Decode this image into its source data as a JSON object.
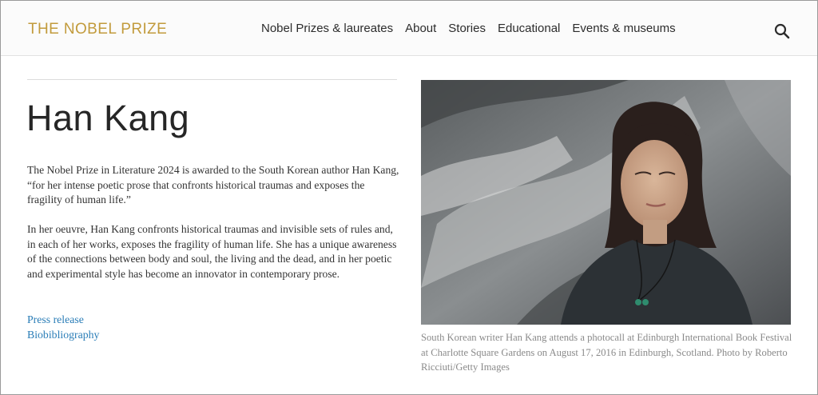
{
  "header": {
    "brand": "THE NOBEL PRIZE",
    "nav": [
      "Nobel Prizes & laureates",
      "About",
      "Stories",
      "Educational",
      "Events & museums"
    ],
    "search_icon": "search-icon"
  },
  "main": {
    "title": "Han Kang",
    "paragraphs": [
      "The Nobel Prize in Literature 2024 is awarded to the South Korean author Han Kang, “for her intense poetic prose that confronts historical traumas and exposes the fragility of human life.”",
      "In her oeuvre, Han Kang confronts historical traumas and invisible sets of rules and, in each of her works, exposes the fragility of human life. She has a unique awareness of the connections between body and soul, the living and the dead, and in her poetic and experimental style has become an innovator in contemporary prose."
    ],
    "links": [
      "Press release",
      "Biobibliography"
    ]
  },
  "photo": {
    "caption": "South Korean writer Han Kang attends a photocall at Edinburgh International Book Festival at Charlotte Square Gardens on August 17, 2016 in Edinburgh, Scotland. Photo by Roberto Ricciuti/Getty Images"
  },
  "colors": {
    "brand": "#c29b3c",
    "link": "#2a7db7",
    "caption": "#8a8a8a"
  }
}
